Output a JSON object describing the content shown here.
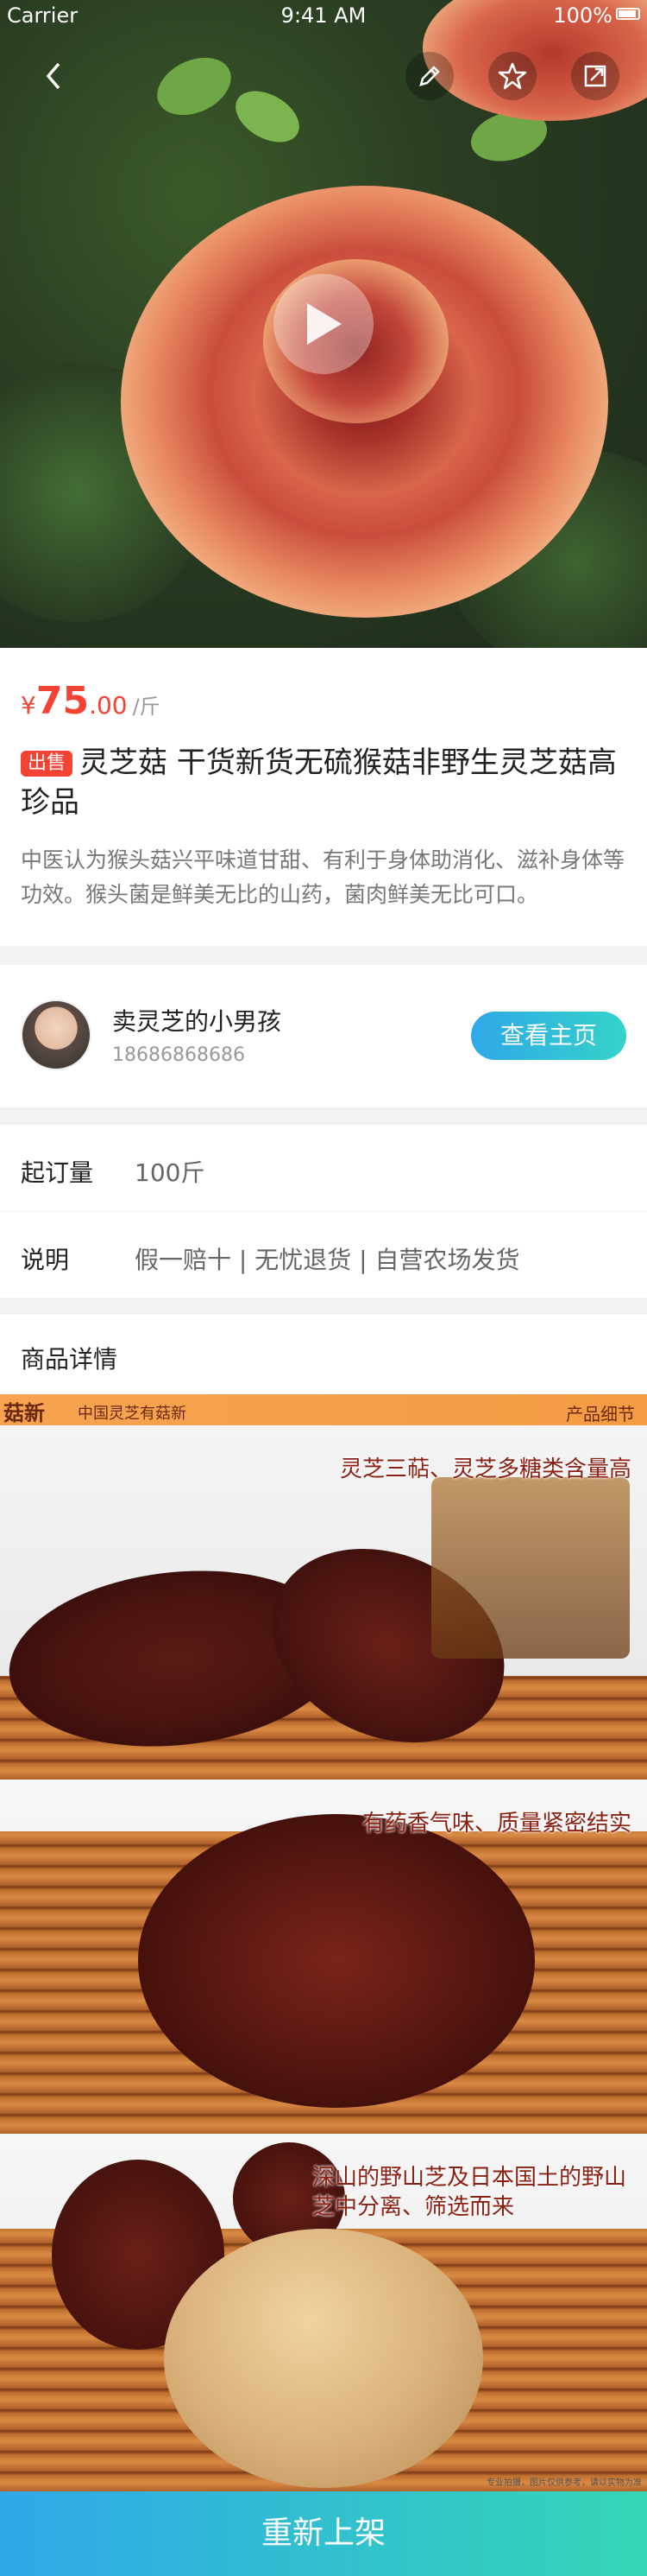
{
  "status_bar": {
    "carrier": "Carrier",
    "time": "9:41 AM",
    "battery": "100%"
  },
  "nav": {
    "back_icon": "chevron-left-icon",
    "edit_icon": "pencil-icon",
    "favorite_icon": "star-icon",
    "share_icon": "share-icon"
  },
  "product": {
    "price_currency": "¥",
    "price_integer": "75",
    "price_decimal": ".00",
    "price_unit": "/斤",
    "tag": "出售",
    "title": "灵芝菇 干货新货无硫猴菇非野生灵芝菇高珍品",
    "description": "中医认为猴头菇兴平味道甘甜、有利于身体助消化、滋补身体等功效。猴头菌是鲜美无比的山药，菌肉鲜美无比可口。"
  },
  "seller": {
    "name": "卖灵芝的小男孩",
    "phone": "18686868686",
    "home_button": "查看主页"
  },
  "attributes": [
    {
      "key": "起订量",
      "value": "100斤"
    },
    {
      "key": "说明",
      "value": "假一赔十 | 无忧退货 | 自营农场发货"
    }
  ],
  "details": {
    "heading": "商品详情",
    "banner_logo": "菇新",
    "banner_slogan": "中国灵芝有菇新",
    "banner_right": "产品细节",
    "captions": [
      "灵芝三萜、灵芝多糖类含量高",
      "有药香气味、质量紧密结实",
      "深山的野山芝及日本国土的野山芝中分离、筛选而来"
    ],
    "footnote": "专业拍摄，图片仅供参考，请以实物为准"
  },
  "bottom_button": "重新上架",
  "colors": {
    "price": "#f44334",
    "accent_start": "#2fa8e8",
    "accent_end": "#35d6b6"
  }
}
